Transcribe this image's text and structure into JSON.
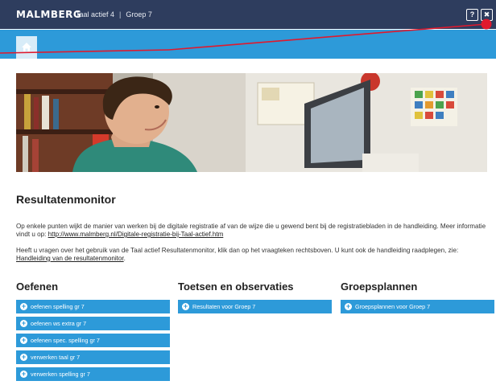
{
  "header": {
    "logo": "MALMBERG",
    "app_name": "Taal actief 4",
    "separator": "|",
    "group": "Groep 7",
    "help_label": "?",
    "close_label": "✖"
  },
  "nav": {
    "home_icon": "home-icon"
  },
  "page": {
    "title": "Resultatenmonitor",
    "paragraph1": {
      "text": "Op enkele punten wijkt de manier van werken bij de digitale registratie af van de wijze die u gewend bent bij de registratiebladen in de handleiding. Meer informatie vindt u op: ",
      "link": "http://www.malmberg.nl/Digitale-registratie-bij-Taal-actief.htm"
    },
    "paragraph2": {
      "text": "Heeft u vragen over het gebruik van de Taal actief Resultatenmonitor, klik dan op het vraagteken rechtsboven. U kunt ook de handleiding raadplegen, zie: ",
      "link": "Handleiding van de resultatenmonitor",
      "end": "."
    }
  },
  "columns": [
    {
      "title": "Oefenen",
      "buttons": [
        "oefenen spelling gr 7",
        "oefenen ws extra gr 7",
        "oefenen spec. spelling gr 7",
        "verwerken taal gr 7",
        "verwerken spelling gr 7"
      ]
    },
    {
      "title": "Toetsen en observaties",
      "buttons": [
        "Resultaten voor Groep 7"
      ]
    },
    {
      "title": "Groepsplannen",
      "buttons": [
        "Groepsplannen voor Groep 7"
      ]
    }
  ],
  "colors": {
    "header_bg": "#2e3d5e",
    "nav_bg": "#2d9ad9",
    "button_bg": "#2d9ad9",
    "annotation": "#e0192d"
  }
}
